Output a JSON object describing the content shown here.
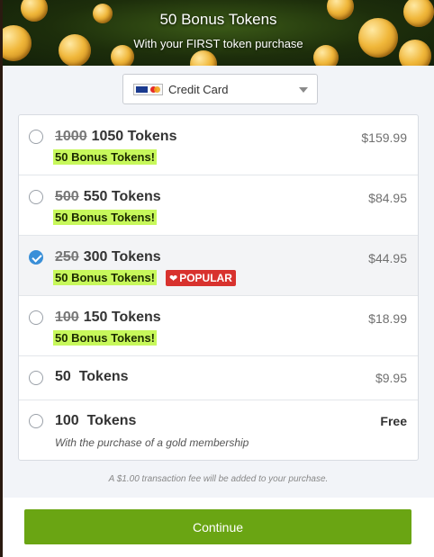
{
  "banner": {
    "title": "50 Bonus Tokens",
    "subtitle": "With your FIRST token purchase"
  },
  "payment": {
    "selected": "Credit Card",
    "icon": "credit-card-icon"
  },
  "options": [
    {
      "old": "1000",
      "new": "1050",
      "unit": "Tokens",
      "price": "$159.99",
      "bonus": "50 Bonus Tokens!",
      "selected": false
    },
    {
      "old": "500",
      "new": "550",
      "unit": "Tokens",
      "price": "$84.95",
      "bonus": "50 Bonus Tokens!",
      "selected": false
    },
    {
      "old": "250",
      "new": "300",
      "unit": "Tokens",
      "price": "$44.95",
      "bonus": "50 Bonus Tokens!",
      "selected": true,
      "badge": "POPULAR"
    },
    {
      "old": "100",
      "new": "150",
      "unit": "Tokens",
      "price": "$18.99",
      "bonus": "50 Bonus Tokens!",
      "selected": false
    },
    {
      "amount": "50",
      "unit": "Tokens",
      "price": "$9.95",
      "selected": false
    },
    {
      "amount": "100",
      "unit": "Tokens",
      "price": "Free",
      "note": "With the purchase of a gold membership",
      "selected": false
    }
  ],
  "fee_note": "A $1.00 transaction fee will be added to your purchase.",
  "continue_label": "Continue",
  "colors": {
    "accent_green": "#6aa513",
    "bonus_highlight": "#c7f85b",
    "popular_red": "#d8322e",
    "radio_blue": "#3a8fd8"
  }
}
